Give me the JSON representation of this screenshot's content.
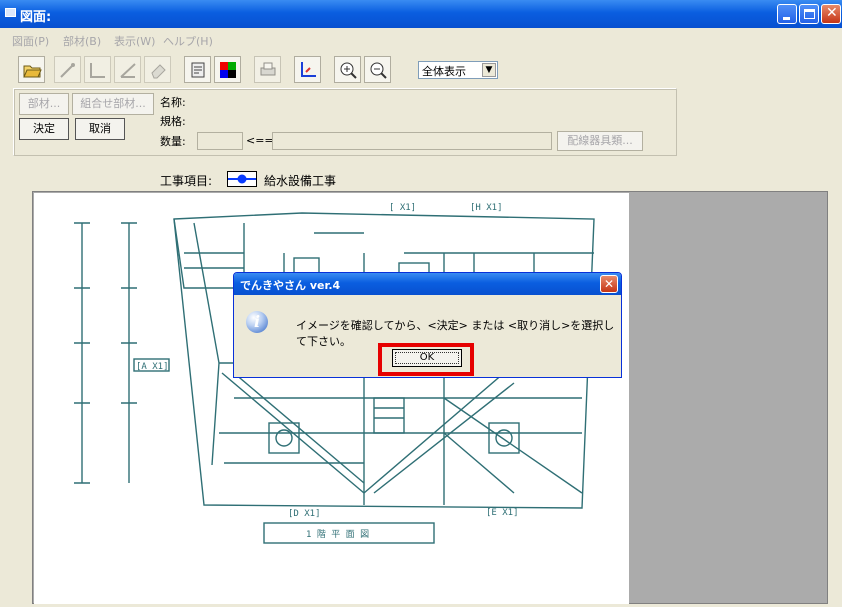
{
  "window": {
    "title": "図面:"
  },
  "menu": [
    "図面(P)",
    "部材(B)",
    "表示(W)",
    "ヘルプ(H)"
  ],
  "toolbar": {
    "zoom_value": "全体表示",
    "icons": [
      "open-folder-icon",
      "wire-tool-icon",
      "bend-tool-icon",
      "angle-tool-icon",
      "erase-tool-icon",
      "parts-icon",
      "color-palette-icon",
      "print-icon",
      "axis-icon",
      "zoom-in-icon",
      "zoom-out-icon"
    ]
  },
  "panel": {
    "buzai_button": "部材...",
    "kumiawase_button": "組合せ部材...",
    "kettei_button": "決定",
    "torikeshi_button": "取消",
    "meisho_label": "名称:",
    "kikaku_label": "規格:",
    "suuryou_label": "数量:",
    "arrow_label": "<==",
    "haisen_button": "配線器具類..."
  },
  "kouji": {
    "label": "工事項目:",
    "value": "給水設備工事",
    "color": "#0a3cff"
  },
  "dialog": {
    "title": "でんきやさん ver.4",
    "message": "イメージを確認してから、<決定> または <取り消し>を選択して下さい。",
    "ok_label": "OK"
  },
  "drawing": {
    "labels": [
      "[ X1]",
      "[H X1]",
      "[A X1]",
      "[D X1]",
      "[E X1]",
      "1 階 平 面 図"
    ]
  }
}
